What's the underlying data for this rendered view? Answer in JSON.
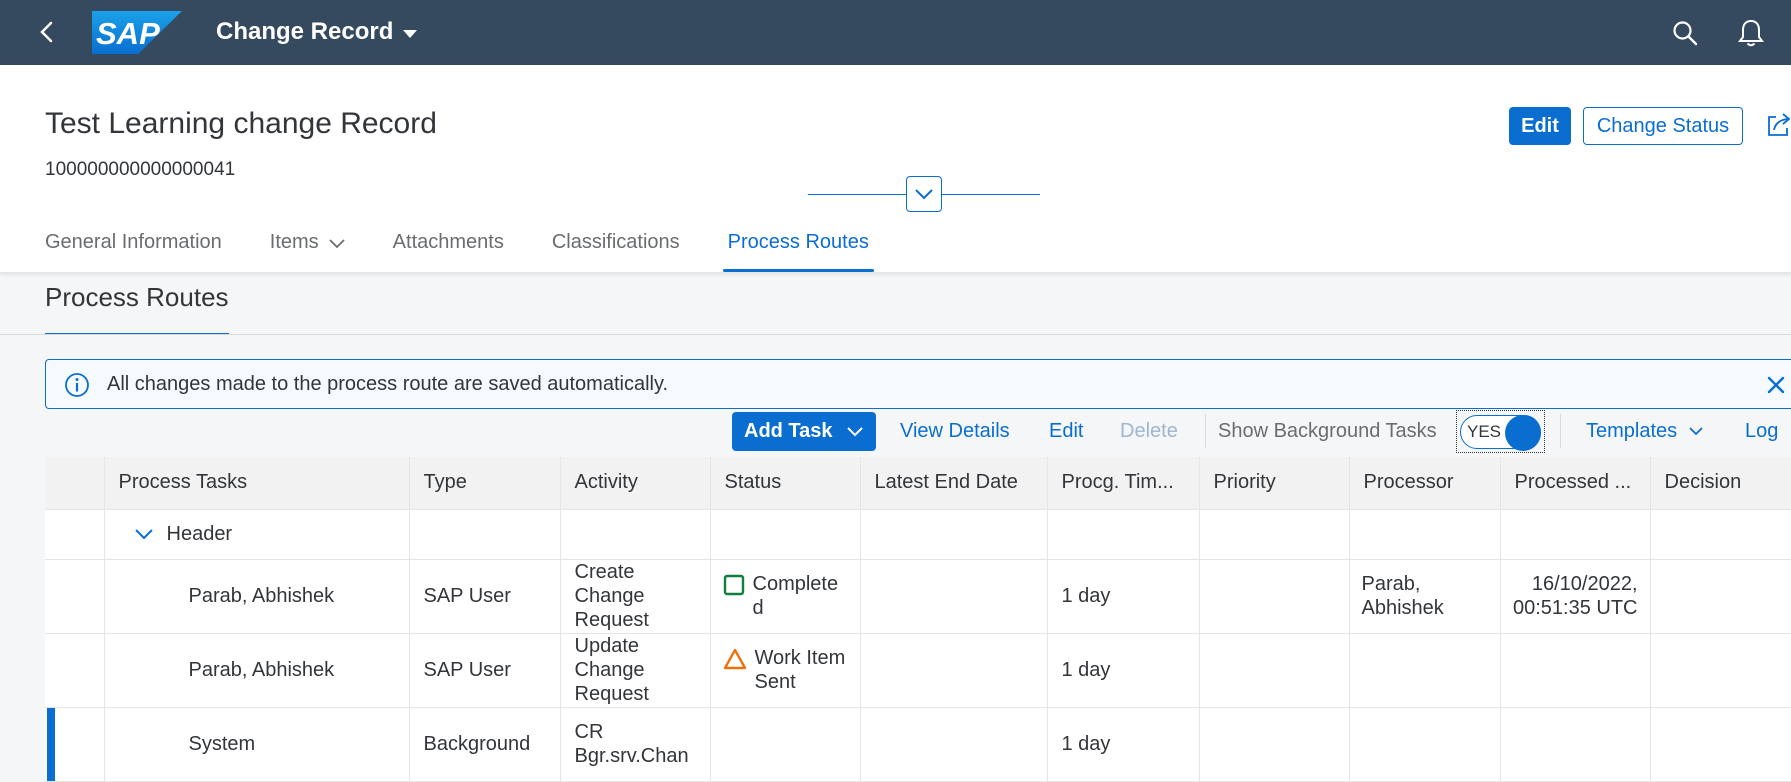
{
  "shell": {
    "logo_text": "SAP",
    "app_title": "Change Record"
  },
  "object": {
    "title": "Test Learning change Record",
    "id": "100000000000000041",
    "edit_label": "Edit",
    "change_status_label": "Change Status"
  },
  "tabs": [
    {
      "label": "General Information"
    },
    {
      "label": "Items"
    },
    {
      "label": "Attachments"
    },
    {
      "label": "Classifications"
    },
    {
      "label": "Process Routes"
    }
  ],
  "section": {
    "title": "Process Routes"
  },
  "message": {
    "text": "All changes made to the process route are saved automatically."
  },
  "toolbar": {
    "add_task": "Add Task",
    "view_details": "View Details",
    "edit": "Edit",
    "delete": "Delete",
    "show_background_tasks": "Show Background Tasks",
    "toggle_value": "YES",
    "templates": "Templates",
    "log": "Log"
  },
  "table": {
    "columns": [
      "Process Tasks",
      "Type",
      "Activity",
      "Status",
      "Latest End Date",
      "Procg. Tim...",
      "Priority",
      "Processor",
      "Processed ...",
      "Decision"
    ],
    "header_row": {
      "label": "Header"
    },
    "rows": [
      {
        "task": "Parab, Abhishek",
        "type": "SAP User",
        "activity": "Create Change Request",
        "status": "Complete d",
        "latest_end_date": "",
        "procg_time": "1 day",
        "priority": "",
        "processor": "Parab, Abhishek",
        "processed": "16/10/2022, 00:51:35 UTC",
        "decision": ""
      },
      {
        "task": "Parab, Abhishek",
        "type": "SAP User",
        "activity": "Update Change Request",
        "status": "Work Item Sent",
        "latest_end_date": "",
        "procg_time": "1 day",
        "priority": "",
        "processor": "",
        "processed": "",
        "decision": ""
      },
      {
        "task": "System",
        "type": "Background",
        "activity": "CR Bgr.srv.Chan",
        "status": "",
        "latest_end_date": "",
        "procg_time": "1 day",
        "priority": "",
        "processor": "",
        "processed": "",
        "decision": ""
      }
    ]
  },
  "colors": {
    "shell_bg": "#354a5f",
    "accent": "#0a6ed1",
    "success": "#107e3e",
    "warning": "#e9730c"
  }
}
